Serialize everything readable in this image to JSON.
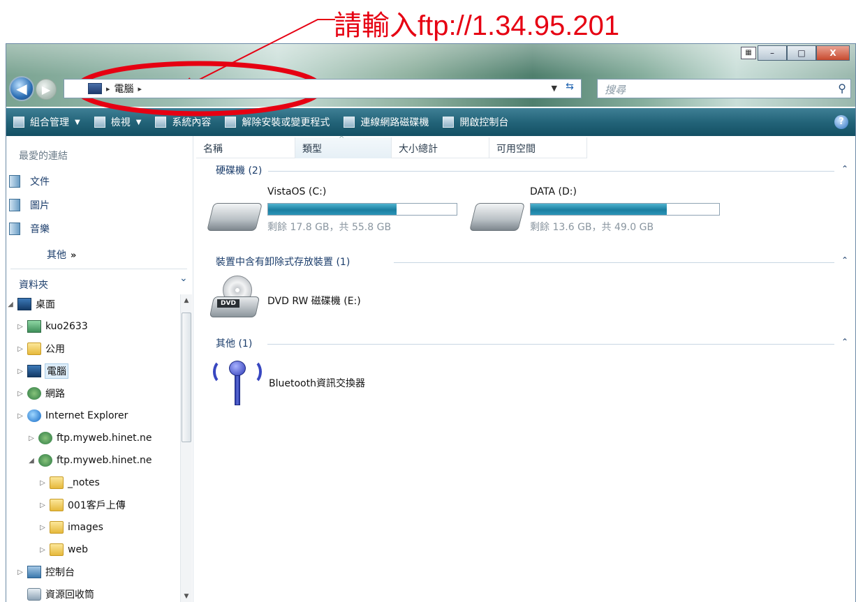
{
  "annotation": {
    "text": "請輸入ftp://1.34.95.201",
    "color": "#e60012"
  },
  "window": {
    "buttons": {
      "minimize": "–",
      "maximize": "□",
      "close": "X"
    },
    "view_icon": "layout-icon"
  },
  "navigation": {
    "back": "◀",
    "forward": "▶",
    "address": {
      "separator": "▸",
      "location": "電腦",
      "trailing_separator": "▸"
    },
    "search_placeholder": "搜尋"
  },
  "toolbar": {
    "items": [
      {
        "label": "組合管理",
        "dropdown": true
      },
      {
        "label": "檢視",
        "dropdown": true
      },
      {
        "label": "系統內容",
        "dropdown": false
      },
      {
        "label": "解除安裝或變更程式",
        "dropdown": false
      },
      {
        "label": "連線網路磁碟機",
        "dropdown": false
      },
      {
        "label": "開啟控制台",
        "dropdown": false
      }
    ],
    "help": "?",
    "color": "#236479"
  },
  "sidebar": {
    "favorites_header": "最愛的連結",
    "favorites": [
      {
        "label": "文件",
        "icon": "documents-icon"
      },
      {
        "label": "圖片",
        "icon": "pictures-icon"
      },
      {
        "label": "音樂",
        "icon": "music-icon"
      }
    ],
    "more": "其他",
    "more_chevrons": "»",
    "folders_header": "資料夾",
    "folders_chevron": "⌄",
    "tree": [
      {
        "label": "桌面",
        "arrow": "◢",
        "icon": "desktop-icon"
      },
      {
        "label": "kuo2633",
        "arrow": "▷",
        "icon": "user-folder-icon"
      },
      {
        "label": "公用",
        "arrow": "▷",
        "icon": "folder-icon"
      },
      {
        "label": "電腦",
        "arrow": "▷",
        "icon": "computer-icon"
      },
      {
        "label": "網路",
        "arrow": "▷",
        "icon": "network-icon"
      },
      {
        "label": "Internet Explorer",
        "arrow": "▷",
        "icon": "internet-explorer-icon"
      },
      {
        "label": "ftp.myweb.hinet.ne",
        "arrow": "▷",
        "icon": "ftp-site-icon"
      },
      {
        "label": "ftp.myweb.hinet.ne",
        "arrow": "◢",
        "icon": "ftp-site-icon"
      },
      {
        "label": "_notes",
        "arrow": "▷",
        "icon": "folder-icon"
      },
      {
        "label": "001客戶上傳",
        "arrow": "▷",
        "icon": "folder-icon"
      },
      {
        "label": "images",
        "arrow": "▷",
        "icon": "folder-icon"
      },
      {
        "label": "web",
        "arrow": "▷",
        "icon": "folder-icon"
      },
      {
        "label": "控制台",
        "arrow": "▷",
        "icon": "control-panel-icon"
      },
      {
        "label": "資源回收筒",
        "arrow": "",
        "icon": "recycle-bin-icon"
      }
    ]
  },
  "columns": [
    "名稱",
    "類型",
    "大小總計",
    "可用空間"
  ],
  "groups": {
    "hard_drives": "硬碟機 (2)",
    "removable": "裝置中含有卸除式存放裝置 (1)",
    "other": "其他 (1)",
    "collapse": "⌃"
  },
  "drives": [
    {
      "name": "VistaOS (C:)",
      "free_text": "剩餘 17.8 GB，共 55.8 GB",
      "used_fraction": 0.681
    },
    {
      "name": "DATA (D:)",
      "free_text": "剩餘 13.6 GB，共 49.0 GB",
      "used_fraction": 0.722
    }
  ],
  "removable_devices": [
    {
      "name": "DVD RW 磁碟機 (E:)",
      "badge": "DVD"
    }
  ],
  "other_devices": [
    {
      "name": "Bluetooth資訊交換器"
    }
  ]
}
